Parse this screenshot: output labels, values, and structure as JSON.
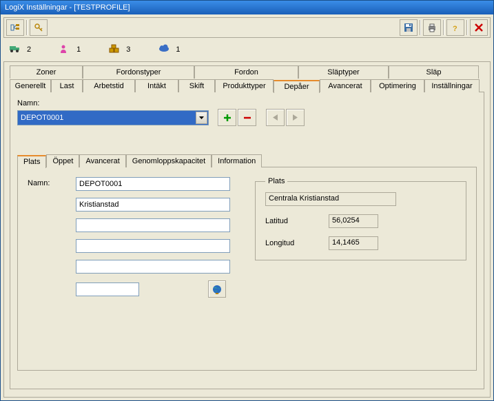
{
  "window": {
    "title": "LogiX Inställningar - [TESTPROFILE]"
  },
  "counts": {
    "truck": "2",
    "person": "1",
    "boxes": "3",
    "cloud": "1"
  },
  "tabs_row1": [
    "Zoner",
    "Fordonstyper",
    "Fordon",
    "Släptyper",
    "Släp"
  ],
  "tabs_row2": [
    "Generellt",
    "Last",
    "Arbetstid",
    "Intäkt",
    "Skift",
    "Produkttyper",
    "Depåer",
    "Avancerat",
    "Optimering",
    "Inställningar"
  ],
  "active_tab": "Depåer",
  "depot": {
    "name_label": "Namn:",
    "selected": "DEPOT0001"
  },
  "subtabs": [
    "Plats",
    "Öppet",
    "Avancerat",
    "Genomloppskapacitet",
    "Information"
  ],
  "active_subtab": "Plats",
  "form": {
    "name_label": "Namn:",
    "name": "DEPOT0001",
    "line2": "Kristianstad",
    "line3": "",
    "line4": "",
    "line5": "",
    "line6": ""
  },
  "plats": {
    "legend": "Plats",
    "locality": "Centrala Kristianstad",
    "lat_label": "Latitud",
    "lat": "56,0254",
    "lon_label": "Longitud",
    "lon": "14,1465"
  }
}
